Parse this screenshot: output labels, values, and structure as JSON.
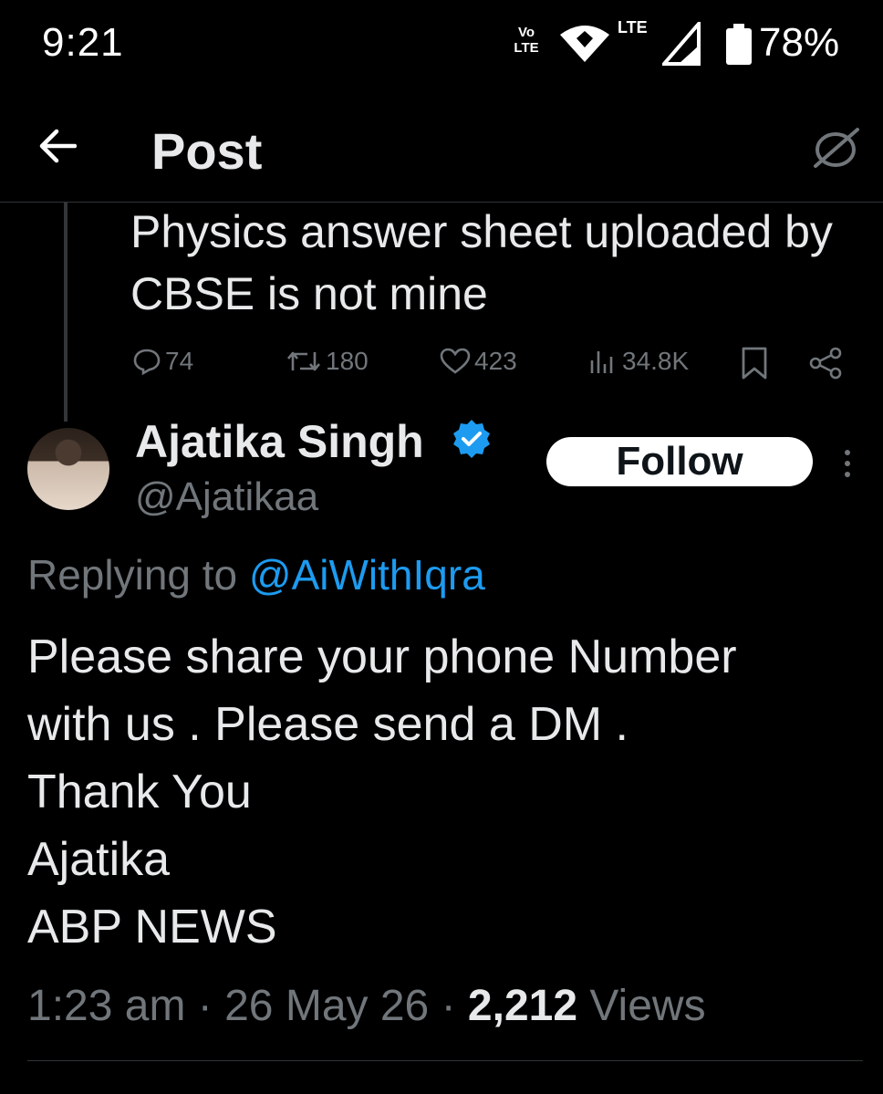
{
  "status_bar": {
    "time": "9:21",
    "volte_line1": "Vo",
    "volte_line2": "LTE",
    "network_label": "LTE",
    "battery_percent": "78%"
  },
  "header": {
    "title": "Post",
    "back_icon": "arrow-left-icon",
    "right_icon": "compose-slash-icon"
  },
  "previous_post": {
    "text": "Physics answer sheet uploaded by CBSE is not mine",
    "metrics": {
      "replies": "74",
      "reposts": "180",
      "likes": "423",
      "views": "34.8K"
    }
  },
  "post": {
    "author_name": "Ajatika Singh",
    "author_handle": "@Ajatikaa",
    "follow_label": "Follow",
    "replying_prefix": "Replying to ",
    "replying_to": "@AiWithIqra",
    "body_lines": [
      "Please share your phone Number",
      "with us . Please send a DM .",
      "Thank You",
      "Ajatika",
      "ABP NEWS"
    ],
    "time": "1:23 am",
    "separator": "·",
    "date": "26 May 26",
    "views_count": "2,212",
    "views_label": "Views"
  },
  "colors": {
    "background": "#000000",
    "text": "#e7e9ea",
    "muted": "#71767b",
    "accent": "#1d9bf0",
    "divider": "#2f3336"
  }
}
